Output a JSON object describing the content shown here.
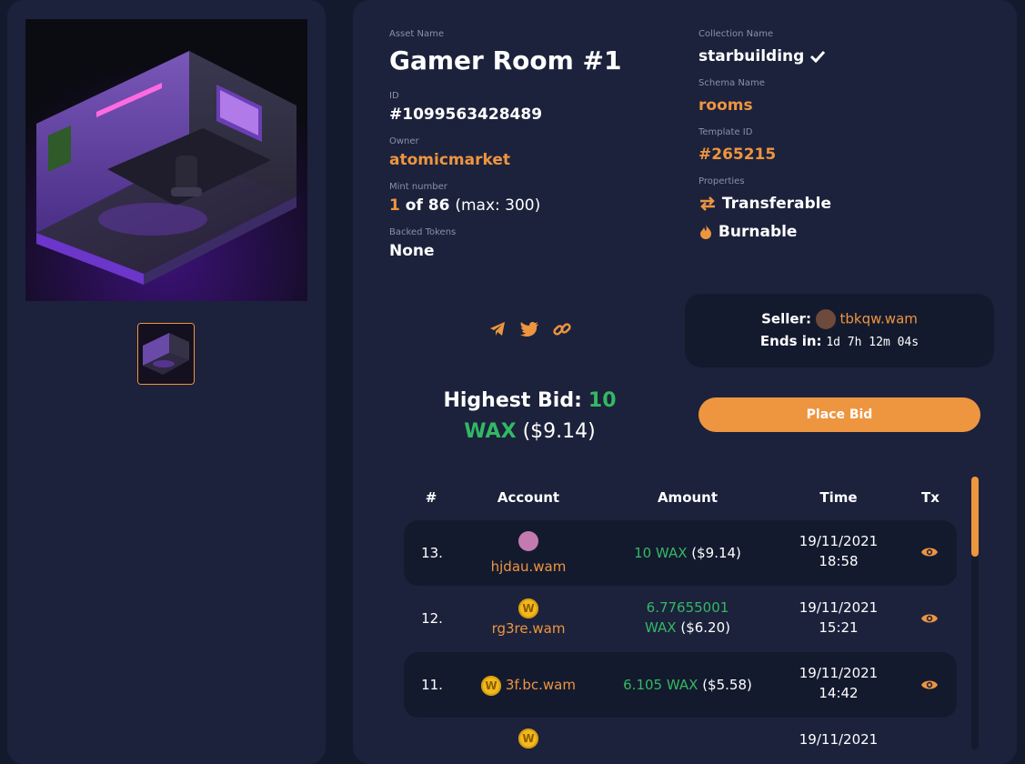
{
  "asset": {
    "name_label": "Asset Name",
    "name": "Gamer Room #1",
    "id_label": "ID",
    "id": "#1099563428489",
    "owner_label": "Owner",
    "owner": "atomicmarket",
    "mint_label": "Mint number",
    "mint_number": "1",
    "mint_of": "of 86",
    "mint_max": "(max: 300)",
    "backed_label": "Backed Tokens",
    "backed": "None"
  },
  "collection": {
    "name_label": "Collection Name",
    "name": "starbuilding",
    "schema_label": "Schema Name",
    "schema": "rooms",
    "template_label": "Template ID",
    "template": "#265215",
    "properties_label": "Properties",
    "properties": [
      "Transferable",
      "Burnable"
    ]
  },
  "share_icons": [
    "telegram-icon",
    "twitter-icon",
    "link-icon"
  ],
  "seller": {
    "seller_label": "Seller:",
    "seller": "tbkqw.wam",
    "ends_label": "Ends in:",
    "ends": "1d 7h 12m 04s"
  },
  "bid": {
    "label": "Highest Bid:",
    "amount": "10",
    "currency": "WAX",
    "usd": "($9.14)",
    "button": "Place Bid"
  },
  "table": {
    "headers": [
      "#",
      "Account",
      "Amount",
      "Time",
      "Tx"
    ],
    "rows": [
      {
        "num": "13.",
        "account": "hjdau.wam",
        "amount": "10 WAX",
        "usd": "($9.14)",
        "date": "19/11/2021",
        "time": "18:58"
      },
      {
        "num": "12.",
        "account": "rg3re.wam",
        "amount_line1": "6.77655001",
        "amount_line2": "WAX",
        "usd": "($6.20)",
        "date": "19/11/2021",
        "time": "15:21"
      },
      {
        "num": "11.",
        "account": "3f.bc.wam",
        "amount": "6.105 WAX",
        "usd": "($5.58)",
        "date": "19/11/2021",
        "time": "14:42"
      },
      {
        "num": "",
        "date": "19/11/2021"
      }
    ]
  },
  "colors": {
    "background": "#141a2e",
    "panel": "#1c223b",
    "accent": "#ee9540",
    "wax_green": "#33b864"
  }
}
